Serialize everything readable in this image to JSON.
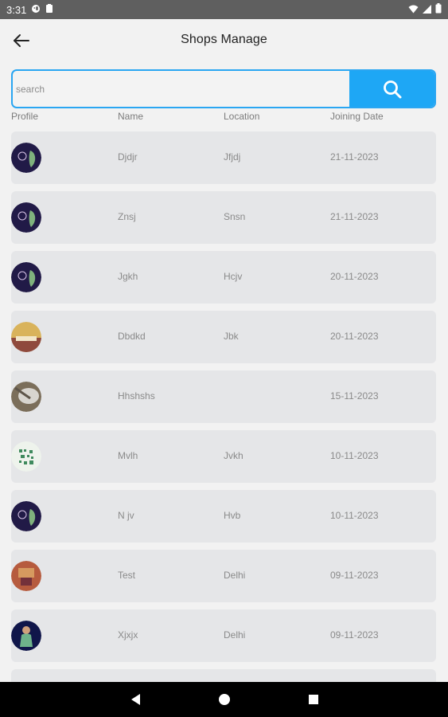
{
  "status_bar": {
    "time": "3:31",
    "icons": [
      "face-icon",
      "battery-saver-icon",
      "wifi-icon",
      "signal-icon",
      "battery-icon"
    ]
  },
  "header": {
    "title": "Shops Manage"
  },
  "search": {
    "placeholder": "search",
    "button_icon": "search-icon"
  },
  "table": {
    "columns": [
      "Profile",
      "Name",
      "Location",
      "Joining Date"
    ],
    "rows": [
      {
        "name": "Djdjr",
        "location": "Jfjdj",
        "date": "21-11-2023"
      },
      {
        "name": "Znsj",
        "location": "Snsn",
        "date": "21-11-2023"
      },
      {
        "name": "Jgkh",
        "location": "Hcjv",
        "date": "20-11-2023"
      },
      {
        "name": "Dbdkd",
        "location": "Jbk",
        "date": "20-11-2023"
      },
      {
        "name": "Hhshshs",
        "location": "",
        "date": "15-11-2023"
      },
      {
        "name": "Mvlh",
        "location": "Jvkh",
        "date": "10-11-2023"
      },
      {
        "name": "N jv",
        "location": "Hvb",
        "date": "10-11-2023"
      },
      {
        "name": "Test",
        "location": "Delhi",
        "date": "09-11-2023"
      },
      {
        "name": "Xjxjx",
        "location": "Delhi",
        "date": "09-11-2023"
      }
    ]
  },
  "colors": {
    "accent": "#1ea7f5",
    "row_bg": "#e5e6e8",
    "page_bg": "#f2f2f2"
  },
  "nav": {
    "buttons": [
      "back-triangle-icon",
      "home-circle-icon",
      "recents-square-icon"
    ]
  }
}
